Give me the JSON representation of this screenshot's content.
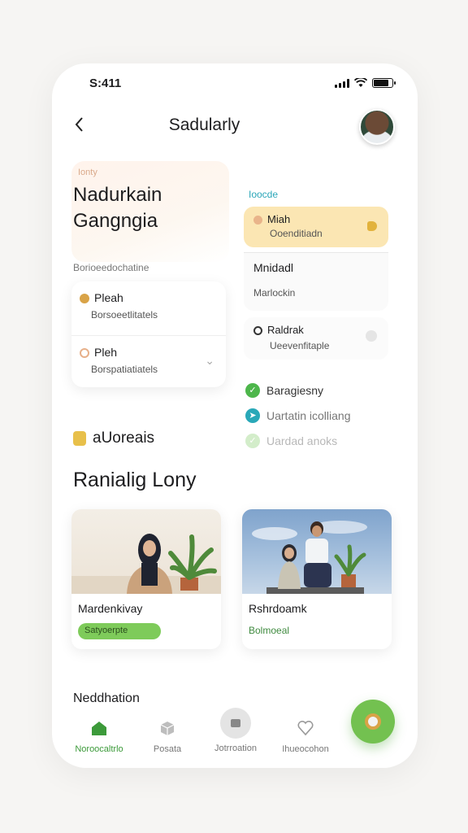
{
  "status": {
    "time": "S:411"
  },
  "header": {
    "title": "Sadularly",
    "back_label": "<"
  },
  "hero": {
    "tag": "Ionty",
    "title": "Nadurkain Gangngia"
  },
  "left_section": {
    "subtitle": "Borioeedochatine",
    "items": [
      {
        "title": "Pleah",
        "sub": "Borsoeetlitatels",
        "dot_color": "#d9a347"
      },
      {
        "title": "Pleh",
        "sub": "Borspatiatiatels",
        "dot_color": "#e7b08a"
      }
    ]
  },
  "right_section": {
    "label": "Ioocde",
    "highlight": {
      "title": "Miah",
      "sub": "Ooenditiadn"
    },
    "box": {
      "title": "Mnidadl",
      "sub": "Marlockin"
    },
    "item": {
      "title": "Raldrak",
      "sub": "Ueevenfitaple"
    },
    "checks": [
      {
        "label": "Baragiesny",
        "color": "#4db64b",
        "faded": false
      },
      {
        "label": "Uartatin icolliang",
        "color": "#29a8b8",
        "faded": false
      },
      {
        "label": "Uardad anoks",
        "color": "#84cc6b",
        "faded": true
      }
    ]
  },
  "badge": {
    "label": "aUoreais",
    "icon": "tag-icon"
  },
  "section": {
    "title": "Ranialig Lony"
  },
  "cards": [
    {
      "name": "Mardenkivay",
      "tag": "Satyoerpte",
      "style": "pill"
    },
    {
      "name": "Rshrdoamk",
      "tag": "Bolmoeal",
      "style": "text"
    }
  ],
  "nav_title": "Neddhation",
  "tabs": [
    {
      "label": "Noroocaltrlo",
      "icon": "home-icon",
      "active": true
    },
    {
      "label": "Posata",
      "icon": "box-icon",
      "active": false
    },
    {
      "label": "Jotrroation",
      "icon": "media-icon",
      "active": false
    },
    {
      "label": "Ihueocohon",
      "icon": "heart-icon",
      "active": false
    }
  ],
  "colors": {
    "accent": "#73c150",
    "highlight": "#fbe6b3",
    "teal": "#2aa6b8"
  }
}
